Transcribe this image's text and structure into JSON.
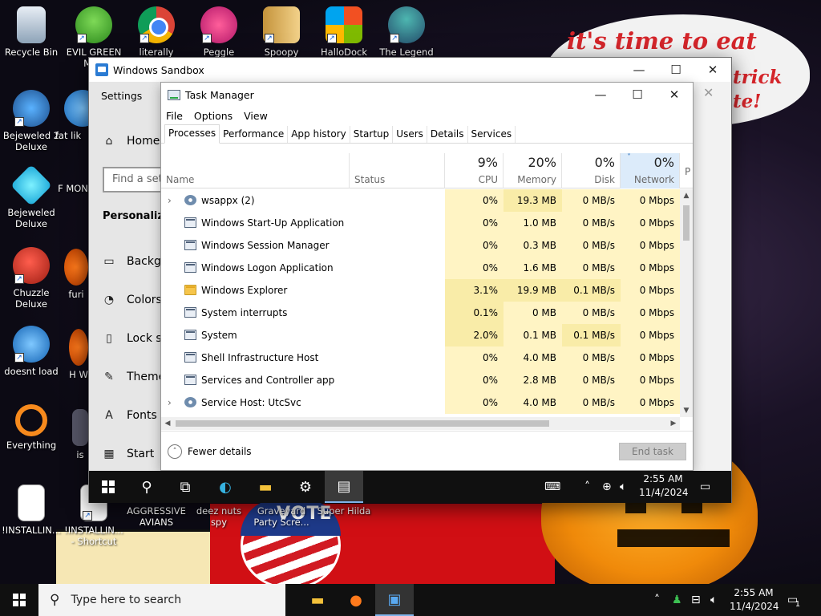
{
  "wallpaper": {
    "line1": "it's time to eat shit",
    "line2": "trick",
    "line3": "te!"
  },
  "desktop_icons": [
    {
      "label": "Recycle Bin",
      "icon": "recycle-bin-icon"
    },
    {
      "label": "EVIL GREEN MEN",
      "icon": "green-men-icon"
    },
    {
      "label": "literally",
      "icon": "chrome-icon"
    },
    {
      "label": "Peggle Nights",
      "icon": "peggle-icon"
    },
    {
      "label": "Spoopy",
      "icon": "spoopy-icon"
    },
    {
      "label": "HalloDock",
      "icon": "hallodock-icon"
    },
    {
      "label": "The Legend",
      "icon": "legend-icon"
    },
    {
      "label": "Bejeweled 2 Deluxe",
      "icon": "bejeweled2-icon"
    },
    {
      "label": "fat lik",
      "icon": "fat-icon"
    },
    {
      "label": "Bejeweled Deluxe",
      "icon": "bejeweled-icon"
    },
    {
      "label": "F MON",
      "icon": "partial-icon"
    },
    {
      "label": "Chuzzle Deluxe",
      "icon": "chuzzle-icon"
    },
    {
      "label": "furi",
      "icon": "firefox-icon"
    },
    {
      "label": "doesnt load",
      "icon": "bird-icon"
    },
    {
      "label": "H W",
      "icon": "partial-icon"
    },
    {
      "label": "Everything",
      "icon": "everything-icon"
    },
    {
      "label": "is",
      "icon": "partial-icon"
    },
    {
      "label": "!INSTALLIN...",
      "icon": "document-icon"
    },
    {
      "label": "!INSTALLIN... - Shortcut",
      "icon": "document-icon"
    },
    {
      "label": "AGGRESSIVE AVIANS",
      "icon": "avians-icon"
    },
    {
      "label": "deez nuts spy",
      "icon": "spy-icon"
    },
    {
      "label": "Graveyard Party Scre...",
      "icon": "graveyard-icon"
    },
    {
      "label": "Super Hilda",
      "icon": "hilda-icon"
    }
  ],
  "sandbox": {
    "title": "Windows Sandbox",
    "minimize": "—",
    "maximize": "☐",
    "close": "✕"
  },
  "settings": {
    "title": "Settings",
    "home": "Home",
    "find_placeholder": "Find a setting",
    "group": "Personalization",
    "items": [
      "Background",
      "Colors",
      "Lock screen",
      "Themes",
      "Fonts",
      "Start"
    ]
  },
  "taskmgr": {
    "title": "Task Manager",
    "menu": [
      "File",
      "Options",
      "View"
    ],
    "tabs": [
      "Processes",
      "Performance",
      "App history",
      "Startup",
      "Users",
      "Details",
      "Services"
    ],
    "columns": {
      "name": "Name",
      "status": "Status",
      "cpu": {
        "pct": "9%",
        "label": "CPU"
      },
      "memory": {
        "pct": "20%",
        "label": "Memory"
      },
      "disk": {
        "pct": "0%",
        "label": "Disk"
      },
      "network": {
        "pct": "0%",
        "label": "Network"
      },
      "partial": "P"
    },
    "rows": [
      {
        "name": "wsappx (2)",
        "cpu": "0%",
        "mem": "19.3 MB",
        "disk": "0 MB/s",
        "net": "0 Mbps",
        "expand": true,
        "icon": "gear"
      },
      {
        "name": "Windows Start-Up Application",
        "cpu": "0%",
        "mem": "1.0 MB",
        "disk": "0 MB/s",
        "net": "0 Mbps",
        "expand": false,
        "icon": "window"
      },
      {
        "name": "Windows Session Manager",
        "cpu": "0%",
        "mem": "0.3 MB",
        "disk": "0 MB/s",
        "net": "0 Mbps",
        "expand": false,
        "icon": "window"
      },
      {
        "name": "Windows Logon Application",
        "cpu": "0%",
        "mem": "1.6 MB",
        "disk": "0 MB/s",
        "net": "0 Mbps",
        "expand": false,
        "icon": "window"
      },
      {
        "name": "Windows Explorer",
        "cpu": "3.1%",
        "mem": "19.9 MB",
        "disk": "0.1 MB/s",
        "net": "0 Mbps",
        "expand": false,
        "icon": "folder"
      },
      {
        "name": "System interrupts",
        "cpu": "0.1%",
        "mem": "0 MB",
        "disk": "0 MB/s",
        "net": "0 Mbps",
        "expand": false,
        "icon": "window"
      },
      {
        "name": "System",
        "cpu": "2.0%",
        "mem": "0.1 MB",
        "disk": "0.1 MB/s",
        "net": "0 Mbps",
        "expand": false,
        "icon": "window"
      },
      {
        "name": "Shell Infrastructure Host",
        "cpu": "0%",
        "mem": "4.0 MB",
        "disk": "0 MB/s",
        "net": "0 Mbps",
        "expand": false,
        "icon": "window"
      },
      {
        "name": "Services and Controller app",
        "cpu": "0%",
        "mem": "2.8 MB",
        "disk": "0 MB/s",
        "net": "0 Mbps",
        "expand": false,
        "icon": "window"
      },
      {
        "name": "Service Host: UtcSvc",
        "cpu": "0%",
        "mem": "4.0 MB",
        "disk": "0 MB/s",
        "net": "0 Mbps",
        "expand": true,
        "icon": "gear"
      }
    ],
    "fewer_details": "Fewer details",
    "end_task": "End task"
  },
  "sandbox_taskbar": {
    "time": "2:55 AM",
    "date": "11/4/2024"
  },
  "taskbar": {
    "search_placeholder": "Type here to search",
    "time": "2:55 AM",
    "date": "11/4/2024",
    "notification_count": "1"
  },
  "colors": {
    "accent": "#0078d7",
    "heat_light": "#fff4c4",
    "heat_medium": "#f9eca8",
    "sorted_header": "#dcebfa"
  }
}
